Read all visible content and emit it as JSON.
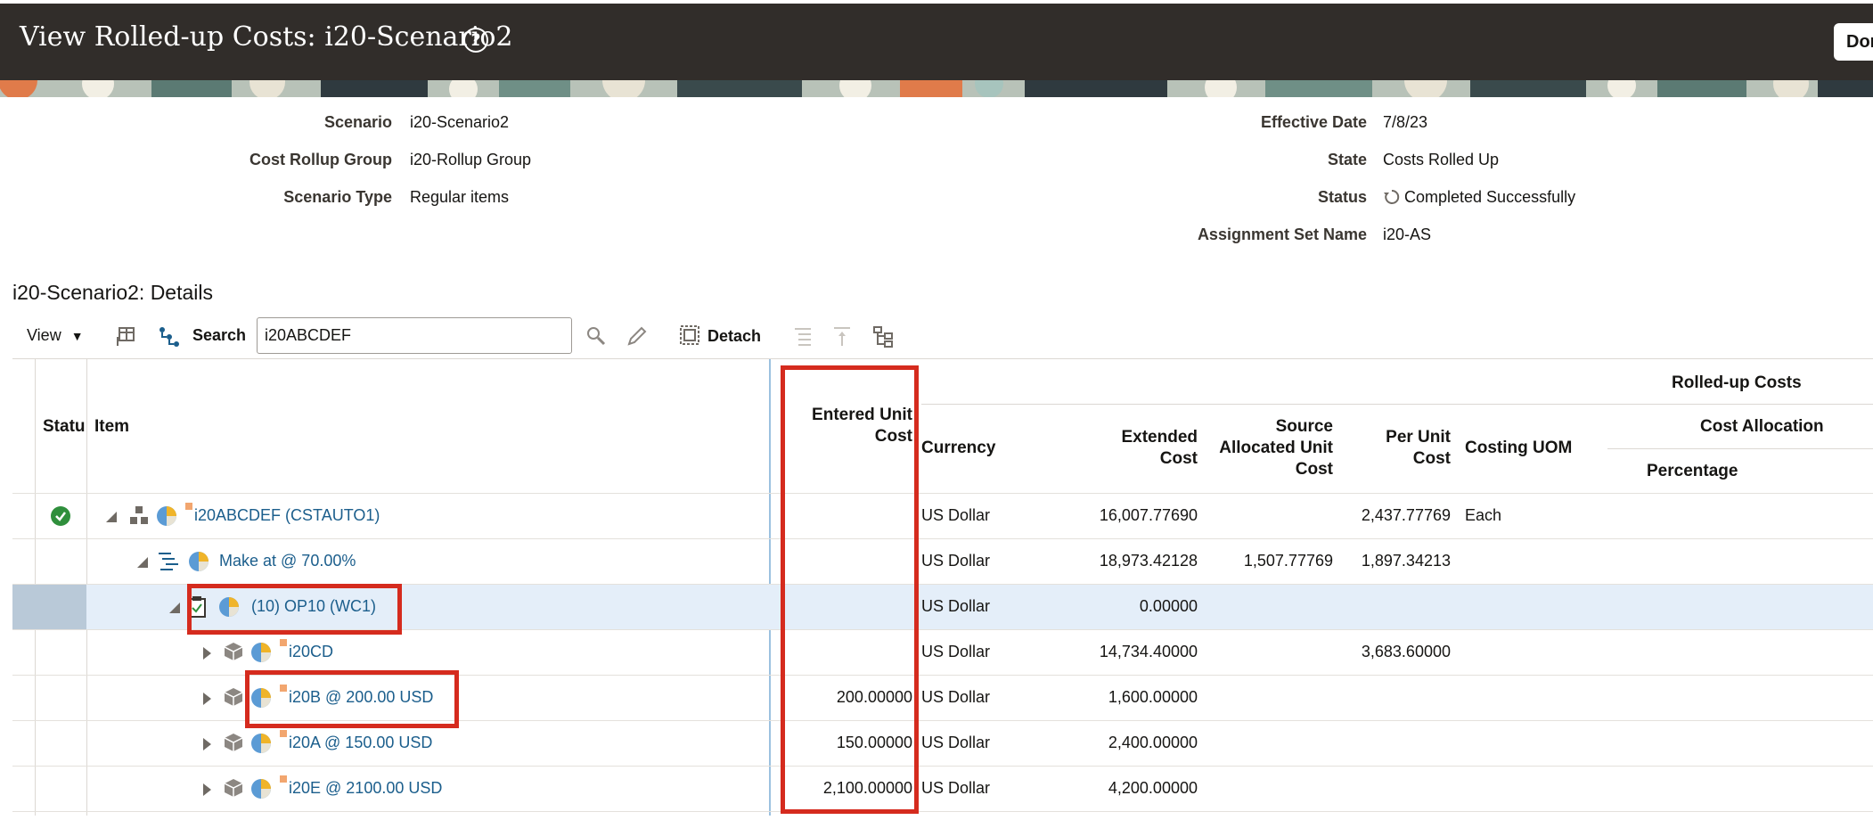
{
  "page": {
    "title": "View Rolled-up Costs: i20-Scenario2",
    "done_label": "Done"
  },
  "header_fields": {
    "scenario_label": "Scenario",
    "scenario_value": "i20-Scenario2",
    "cost_rollup_group_label": "Cost Rollup Group",
    "cost_rollup_group_value": "i20-Rollup Group",
    "scenario_type_label": "Scenario Type",
    "scenario_type_value": "Regular items",
    "effective_date_label": "Effective Date",
    "effective_date_value": "7/8/23",
    "state_label": "State",
    "state_value": "Costs Rolled Up",
    "status_label": "Status",
    "status_value": "Completed Successfully",
    "assignment_set_label": "Assignment Set Name",
    "assignment_set_value": "i20-AS"
  },
  "details": {
    "title": "i20-Scenario2: Details"
  },
  "toolbar": {
    "view_label": "View",
    "search_label": "Search",
    "search_value": "i20ABCDEF",
    "detach_label": "Detach"
  },
  "table": {
    "headers": {
      "status": "Statu",
      "item": "Item",
      "entered_unit_cost_1": "Entered Unit",
      "entered_unit_cost_2": "Cost",
      "currency": "Currency",
      "extended_cost_1": "Extended",
      "extended_cost_2": "Cost",
      "source_alloc_1": "Source",
      "source_alloc_2": "Allocated Unit",
      "source_alloc_3": "Cost",
      "per_unit_cost_1": "Per Unit",
      "per_unit_cost_2": "Cost",
      "costing_uom": "Costing UOM",
      "rolled_up_costs": "Rolled-up Costs",
      "cost_allocation": "Cost Allocation",
      "percentage": "Percentage"
    },
    "rows": [
      {
        "item": "i20ABCDEF (CSTAUTO1)",
        "entered_unit_cost": "",
        "currency": "US Dollar",
        "extended_cost": "16,007.77690",
        "source_allocated": "",
        "per_unit_cost": "2,437.77769",
        "costing_uom": "Each"
      },
      {
        "item": "Make at @ 70.00%",
        "entered_unit_cost": "",
        "currency": "US Dollar",
        "extended_cost": "18,973.42128",
        "source_allocated": "1,507.77769",
        "per_unit_cost": "1,897.34213",
        "costing_uom": ""
      },
      {
        "item": "(10) OP10 (WC1)",
        "entered_unit_cost": "",
        "currency": "US Dollar",
        "extended_cost": "0.00000",
        "source_allocated": "",
        "per_unit_cost": "",
        "costing_uom": ""
      },
      {
        "item": "i20CD",
        "entered_unit_cost": "",
        "currency": "US Dollar",
        "extended_cost": "14,734.40000",
        "source_allocated": "",
        "per_unit_cost": "3,683.60000",
        "costing_uom": ""
      },
      {
        "item": "i20B @ 200.00 USD",
        "entered_unit_cost": "200.00000",
        "currency": "US Dollar",
        "extended_cost": "1,600.00000",
        "source_allocated": "",
        "per_unit_cost": "",
        "costing_uom": ""
      },
      {
        "item": "i20A @ 150.00 USD",
        "entered_unit_cost": "150.00000",
        "currency": "US Dollar",
        "extended_cost": "2,400.00000",
        "source_allocated": "",
        "per_unit_cost": "",
        "costing_uom": ""
      },
      {
        "item": "i20E @ 2100.00 USD",
        "entered_unit_cost": "2,100.00000",
        "currency": "US Dollar",
        "extended_cost": "4,200.00000",
        "source_allocated": "",
        "per_unit_cost": "",
        "costing_uom": ""
      }
    ]
  },
  "colors": {
    "title_bar": "#312d2a",
    "link": "#1b5e8c",
    "selected_row": "#e4eef9",
    "highlight_box": "#d52b1e",
    "success_green": "#2f8f3c"
  }
}
